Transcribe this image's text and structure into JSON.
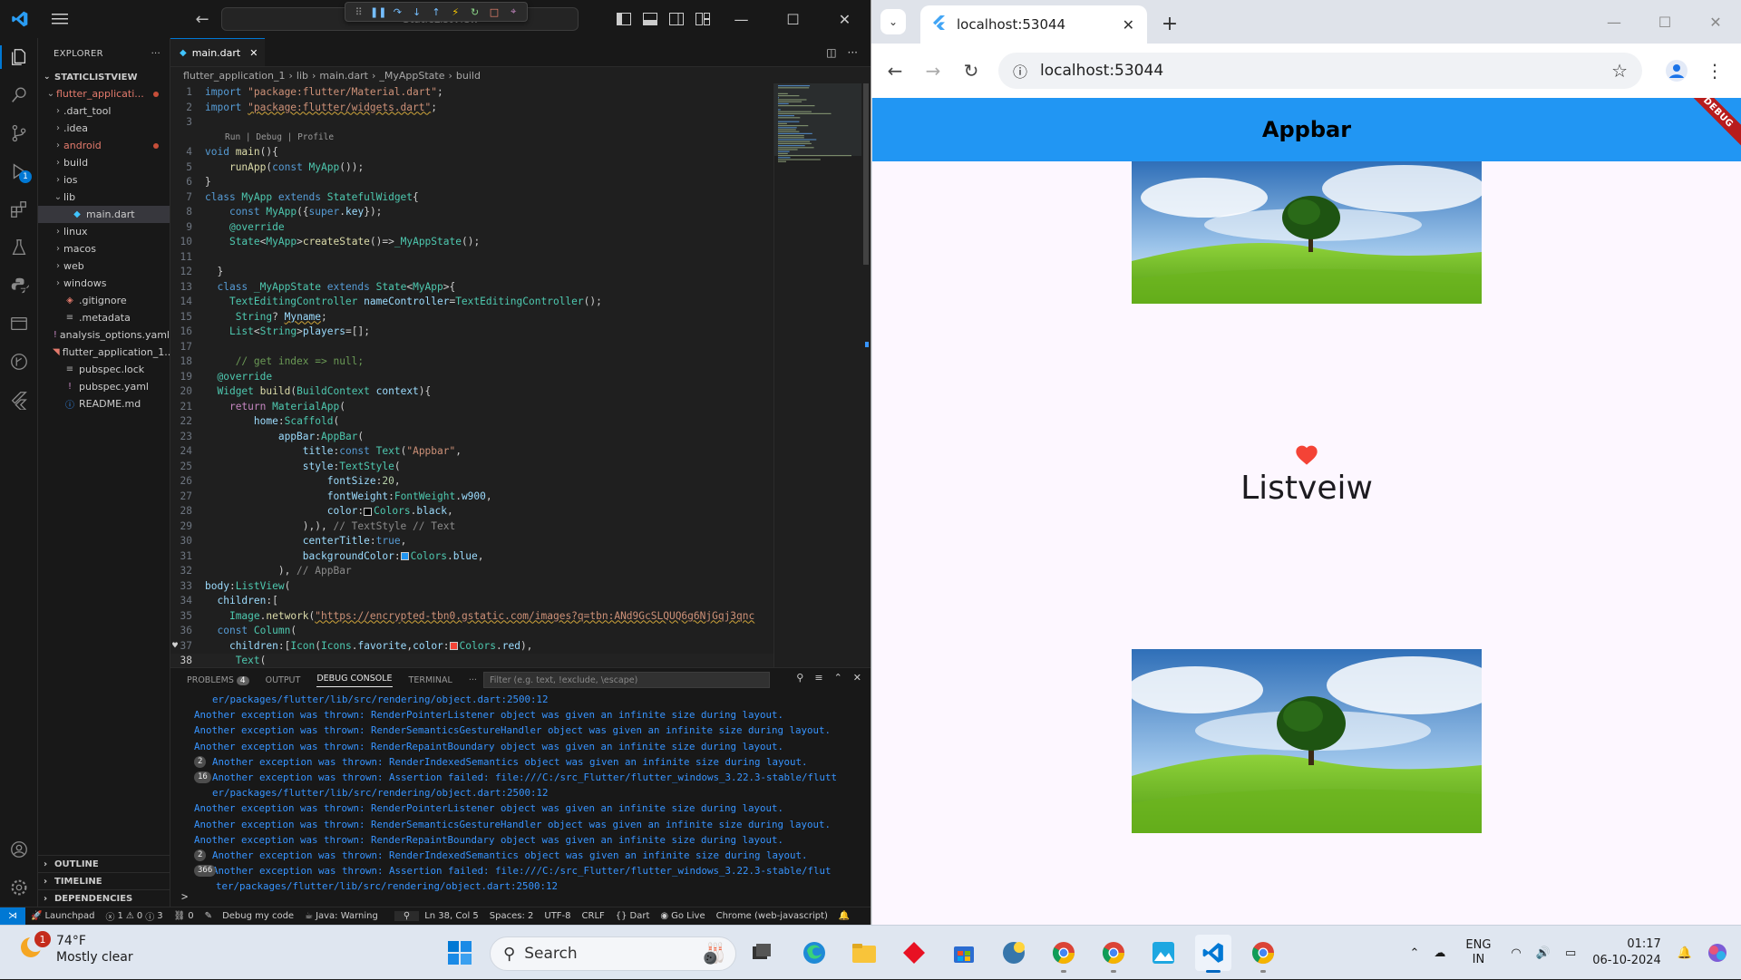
{
  "vscode": {
    "command_center": "StaticListView",
    "explorer": {
      "title": "EXPLORER",
      "project": "STATICLISTVIEW",
      "items": [
        {
          "label": "flutter_applicati...",
          "type": "folder",
          "open": true,
          "depth": 1,
          "color": "#e37a6c",
          "dot": true
        },
        {
          "label": ".dart_tool",
          "type": "folder",
          "depth": 2
        },
        {
          "label": ".idea",
          "type": "folder",
          "depth": 2
        },
        {
          "label": "android",
          "type": "folder",
          "depth": 2,
          "color": "#e37a6c",
          "dot": true
        },
        {
          "label": "build",
          "type": "folder",
          "depth": 2
        },
        {
          "label": "ios",
          "type": "folder",
          "depth": 2
        },
        {
          "label": "lib",
          "type": "folder",
          "open": true,
          "depth": 2
        },
        {
          "label": "main.dart",
          "type": "dart",
          "depth": 3,
          "selected": true
        },
        {
          "label": "linux",
          "type": "folder",
          "depth": 2
        },
        {
          "label": "macos",
          "type": "folder",
          "depth": 2
        },
        {
          "label": "web",
          "type": "folder",
          "depth": 2
        },
        {
          "label": "windows",
          "type": "folder",
          "depth": 2
        },
        {
          "label": ".gitignore",
          "type": "git",
          "depth": 2
        },
        {
          "label": ".metadata",
          "type": "file",
          "depth": 2
        },
        {
          "label": "analysis_options.yaml",
          "type": "yaml",
          "depth": 2
        },
        {
          "label": "flutter_application_1...",
          "type": "rss",
          "depth": 2
        },
        {
          "label": "pubspec.lock",
          "type": "file",
          "depth": 2
        },
        {
          "label": "pubspec.yaml",
          "type": "yaml",
          "depth": 2
        },
        {
          "label": "README.md",
          "type": "info",
          "depth": 2
        }
      ],
      "sections": [
        "OUTLINE",
        "TIMELINE",
        "DEPENDENCIES"
      ]
    },
    "tab": "main.dart",
    "breadcrumbs": [
      "flutter_application_1",
      "lib",
      "main.dart",
      "_MyAppState",
      "build"
    ],
    "codelens": "Run | Debug | Profile",
    "code_lines": [
      {
        "n": "1",
        "tokens": [
          [
            "k",
            "import "
          ],
          [
            "s",
            "\"package:flutter/Material.dart\""
          ],
          [
            "pu",
            ";"
          ]
        ]
      },
      {
        "n": "2",
        "tokens": [
          [
            "k",
            "import "
          ],
          [
            "s sq",
            "\"package:flutter/widgets.dart\""
          ],
          [
            "pu",
            ";"
          ]
        ]
      },
      {
        "n": "3",
        "tokens": []
      },
      {
        "n": "",
        "lens": true
      },
      {
        "n": "4",
        "tokens": [
          [
            "k",
            "void "
          ],
          [
            "f",
            "main"
          ],
          [
            "pu",
            "(){"
          ]
        ]
      },
      {
        "n": "5",
        "tokens": [
          [
            "pu",
            "    "
          ],
          [
            "f",
            "runApp"
          ],
          [
            "pu",
            "("
          ],
          [
            "k",
            "const "
          ],
          [
            "t",
            "MyApp"
          ],
          [
            "pu",
            "());"
          ]
        ]
      },
      {
        "n": "6",
        "tokens": [
          [
            "pu",
            "}"
          ]
        ]
      },
      {
        "n": "7",
        "tokens": [
          [
            "k",
            "class "
          ],
          [
            "t",
            "MyApp "
          ],
          [
            "k",
            "extends "
          ],
          [
            "t",
            "StatefulWidget"
          ],
          [
            "pu",
            "{"
          ]
        ]
      },
      {
        "n": "8",
        "tokens": [
          [
            "pu",
            "    "
          ],
          [
            "k",
            "const "
          ],
          [
            "t",
            "MyApp"
          ],
          [
            "pu",
            "({"
          ],
          [
            "k",
            "super"
          ],
          [
            "pu",
            "."
          ],
          [
            "p",
            "key"
          ],
          [
            "pu",
            "});"
          ]
        ]
      },
      {
        "n": "9",
        "tokens": [
          [
            "pu",
            "    "
          ],
          [
            "t",
            "@override"
          ]
        ]
      },
      {
        "n": "10",
        "tokens": [
          [
            "pu",
            "    "
          ],
          [
            "t",
            "State"
          ],
          [
            "pu",
            "<"
          ],
          [
            "t",
            "MyApp"
          ],
          [
            "pu",
            ">"
          ],
          [
            "f",
            "createState"
          ],
          [
            "pu",
            "()=>"
          ],
          [
            "t",
            "_MyAppState"
          ],
          [
            "pu",
            "();"
          ]
        ]
      },
      {
        "n": "11",
        "tokens": []
      },
      {
        "n": "12",
        "tokens": [
          [
            "pu",
            "  }"
          ]
        ]
      },
      {
        "n": "13",
        "tokens": [
          [
            "pu",
            "  "
          ],
          [
            "k",
            "class "
          ],
          [
            "t",
            "_MyAppState "
          ],
          [
            "k",
            "extends "
          ],
          [
            "t",
            "State"
          ],
          [
            "pu",
            "<"
          ],
          [
            "t",
            "MyApp"
          ],
          [
            "pu",
            ">{"
          ]
        ]
      },
      {
        "n": "14",
        "tokens": [
          [
            "pu",
            "    "
          ],
          [
            "t",
            "TextEditingController "
          ],
          [
            "p",
            "nameController"
          ],
          [
            "pu",
            "="
          ],
          [
            "t",
            "TextEditingController"
          ],
          [
            "pu",
            "();"
          ]
        ]
      },
      {
        "n": "15",
        "tokens": [
          [
            "pu",
            "     "
          ],
          [
            "t",
            "String"
          ],
          [
            "pu",
            "? "
          ],
          [
            "p sq",
            "Myname"
          ],
          [
            "pu",
            ";"
          ]
        ]
      },
      {
        "n": "16",
        "tokens": [
          [
            "pu",
            "    "
          ],
          [
            "t",
            "List"
          ],
          [
            "pu",
            "<"
          ],
          [
            "t",
            "String"
          ],
          [
            "pu",
            ">"
          ],
          [
            "p",
            "players"
          ],
          [
            "pu",
            "=[];"
          ]
        ]
      },
      {
        "n": "17",
        "tokens": []
      },
      {
        "n": "18",
        "tokens": [
          [
            "pu",
            "     "
          ],
          [
            "c",
            "// get index => null;"
          ]
        ]
      },
      {
        "n": "19",
        "tokens": [
          [
            "pu",
            "  "
          ],
          [
            "t",
            "@override"
          ]
        ]
      },
      {
        "n": "20",
        "tokens": [
          [
            "pu",
            "  "
          ],
          [
            "t",
            "Widget "
          ],
          [
            "f",
            "build"
          ],
          [
            "pu",
            "("
          ],
          [
            "t",
            "BuildContext "
          ],
          [
            "p",
            "context"
          ],
          [
            "pu",
            "){"
          ]
        ]
      },
      {
        "n": "21",
        "tokens": [
          [
            "pu",
            "    "
          ],
          [
            "kc",
            "return "
          ],
          [
            "t",
            "MaterialApp"
          ],
          [
            "pu",
            "("
          ]
        ]
      },
      {
        "n": "22",
        "tokens": [
          [
            "pu",
            "        "
          ],
          [
            "p",
            "home"
          ],
          [
            "pu",
            ":"
          ],
          [
            "t",
            "Scaffold"
          ],
          [
            "pu",
            "("
          ]
        ]
      },
      {
        "n": "23",
        "tokens": [
          [
            "pu",
            "            "
          ],
          [
            "p",
            "appBar"
          ],
          [
            "pu",
            ":"
          ],
          [
            "t",
            "AppBar"
          ],
          [
            "pu",
            "("
          ]
        ]
      },
      {
        "n": "24",
        "tokens": [
          [
            "pu",
            "                "
          ],
          [
            "p",
            "title"
          ],
          [
            "pu",
            ":"
          ],
          [
            "k",
            "const "
          ],
          [
            "t",
            "Text"
          ],
          [
            "pu",
            "("
          ],
          [
            "s",
            "\"Appbar\""
          ],
          [
            "pu",
            ","
          ]
        ]
      },
      {
        "n": "25",
        "tokens": [
          [
            "pu",
            "                "
          ],
          [
            "p",
            "style"
          ],
          [
            "pu",
            ":"
          ],
          [
            "t",
            "TextStyle"
          ],
          [
            "pu",
            "("
          ]
        ]
      },
      {
        "n": "26",
        "tokens": [
          [
            "pu",
            "                    "
          ],
          [
            "p",
            "fontSize"
          ],
          [
            "pu",
            ":"
          ],
          [
            "n",
            "20"
          ],
          [
            "pu",
            ","
          ]
        ]
      },
      {
        "n": "27",
        "tokens": [
          [
            "pu",
            "                    "
          ],
          [
            "p",
            "fontWeight"
          ],
          [
            "pu",
            ":"
          ],
          [
            "t",
            "FontWeight"
          ],
          [
            "pu",
            "."
          ],
          [
            "p",
            "w900"
          ],
          [
            "pu",
            ","
          ]
        ]
      },
      {
        "n": "28",
        "tokens": [
          [
            "pu",
            "                    "
          ],
          [
            "p",
            "color"
          ],
          [
            "pu",
            ":"
          ],
          [
            "sw",
            "#000000"
          ],
          [
            "t",
            "Colors"
          ],
          [
            "pu",
            "."
          ],
          [
            "p",
            "black"
          ],
          [
            "pu",
            ","
          ]
        ]
      },
      {
        "n": "29",
        "tokens": [
          [
            "pu",
            "                "
          ],
          [
            "pu",
            "),),"
          ],
          [
            "g",
            " // TextStyle // Text"
          ]
        ]
      },
      {
        "n": "30",
        "tokens": [
          [
            "pu",
            "                "
          ],
          [
            "p",
            "centerTitle"
          ],
          [
            "pu",
            ":"
          ],
          [
            "k",
            "true"
          ],
          [
            "pu",
            ","
          ]
        ]
      },
      {
        "n": "31",
        "tokens": [
          [
            "pu",
            "                "
          ],
          [
            "p",
            "backgroundColor"
          ],
          [
            "pu",
            ":"
          ],
          [
            "sw",
            "#2196f3"
          ],
          [
            "t",
            "Colors"
          ],
          [
            "pu",
            "."
          ],
          [
            "p",
            "blue"
          ],
          [
            "pu",
            ","
          ]
        ]
      },
      {
        "n": "32",
        "tokens": [
          [
            "pu",
            "            "
          ],
          [
            "pu",
            "),"
          ],
          [
            "g",
            " // AppBar"
          ]
        ]
      },
      {
        "n": "33",
        "tokens": [
          [
            "p",
            "body"
          ],
          [
            "pu",
            ":"
          ],
          [
            "t",
            "ListView"
          ],
          [
            "pu",
            "("
          ]
        ]
      },
      {
        "n": "34",
        "tokens": [
          [
            "pu",
            "  "
          ],
          [
            "p",
            "children"
          ],
          [
            "pu",
            ":["
          ]
        ]
      },
      {
        "n": "35",
        "tokens": [
          [
            "pu",
            "    "
          ],
          [
            "t",
            "Image"
          ],
          [
            "pu",
            "."
          ],
          [
            "f",
            "network"
          ],
          [
            "pu",
            "("
          ],
          [
            "s sq",
            "\"https://encrypted-tbn0.gstatic.com/images?q=tbn:ANd9GcSLQUQ6g6NjGqj3qnc"
          ]
        ]
      },
      {
        "n": "36",
        "tokens": [
          [
            "pu",
            "  "
          ],
          [
            "k",
            "const "
          ],
          [
            "t",
            "Column"
          ],
          [
            "pu",
            "("
          ]
        ]
      },
      {
        "n": "37",
        "tokens": [
          [
            "pu",
            "    "
          ],
          [
            "p",
            "children"
          ],
          [
            "pu",
            ":["
          ],
          [
            "t",
            "Icon"
          ],
          [
            "pu",
            "("
          ],
          [
            "t",
            "Icons"
          ],
          [
            "pu",
            "."
          ],
          [
            "p",
            "favorite"
          ],
          [
            "pu",
            ","
          ],
          [
            "p",
            "color"
          ],
          [
            "pu",
            ":"
          ],
          [
            "sw",
            "#f44336"
          ],
          [
            "t",
            "Colors"
          ],
          [
            "pu",
            "."
          ],
          [
            "p",
            "red"
          ],
          [
            "pu",
            "),"
          ]
        ],
        "heart": true
      },
      {
        "n": "38",
        "tokens": [
          [
            "pu",
            "     "
          ],
          [
            "t",
            "Text"
          ],
          [
            "pu",
            "("
          ]
        ],
        "current": true
      }
    ],
    "panel": {
      "tabs": [
        {
          "label": "PROBLEMS",
          "count": "4"
        },
        {
          "label": "OUTPUT"
        },
        {
          "label": "DEBUG CONSOLE",
          "selected": true
        },
        {
          "label": "TERMINAL"
        }
      ],
      "filter_placeholder": "Filter (e.g. text, !exclude, \\escape)",
      "console": [
        {
          "text": "er/packages/flutter/lib/src/rendering/object.dart:2500:12",
          "indent": true
        },
        {
          "text": "Another exception was thrown: RenderPointerListener object was given an infinite size during layout."
        },
        {
          "text": "Another exception was thrown: RenderSemanticsGestureHandler object was given an infinite size during layout."
        },
        {
          "text": "Another exception was thrown: RenderRepaintBoundary object was given an infinite size during layout."
        },
        {
          "count": "2",
          "text": "Another exception was thrown: RenderIndexedSemantics object was given an infinite size during layout."
        },
        {
          "count": "16",
          "text": "Another exception was thrown: Assertion failed: file:///C:/src_Flutter/flutter_windows_3.22.3-stable/flutt"
        },
        {
          "text": "er/packages/flutter/lib/src/rendering/object.dart:2500:12",
          "indent": true
        },
        {
          "text": "Another exception was thrown: RenderPointerListener object was given an infinite size during layout."
        },
        {
          "text": "Another exception was thrown: RenderSemanticsGestureHandler object was given an infinite size during layout."
        },
        {
          "text": "Another exception was thrown: RenderRepaintBoundary object was given an infinite size during layout."
        },
        {
          "count": "2",
          "text": "Another exception was thrown: RenderIndexedSemantics object was given an infinite size during layout."
        },
        {
          "count": "366",
          "text": "Another exception was thrown: Assertion failed: file:///C:/src_Flutter/flutter_windows_3.22.3-stable/flut"
        },
        {
          "text": "ter/packages/flutter/lib/src/rendering/object.dart:2500:12",
          "indent2": true
        }
      ],
      "prompt": ">"
    },
    "status": {
      "launchpad": "Launchpad",
      "errors": "1",
      "warnings": "0",
      "infos": "3",
      "ports": "0",
      "debug_code": "Debug my code",
      "java": "Java: Warning",
      "position": "Ln 38, Col 5",
      "spaces": "Spaces: 2",
      "encoding": "UTF-8",
      "eol": "CRLF",
      "language": "Dart",
      "golive": "Go Live",
      "device": "Chrome (web-javascript)"
    }
  },
  "chrome": {
    "tab_title": "localhost:53044",
    "url": "localhost:53044",
    "app": {
      "appbar_title": "Appbar",
      "debug_banner": "DEBUG",
      "center_text": "Listveiw"
    }
  },
  "taskbar": {
    "weather_temp": "74°F",
    "weather_desc": "Mostly clear",
    "weather_badge": "1",
    "search_label": "Search",
    "lang_line1": "ENG",
    "lang_line2": "IN",
    "time": "01:17",
    "date": "06-10-2024"
  }
}
